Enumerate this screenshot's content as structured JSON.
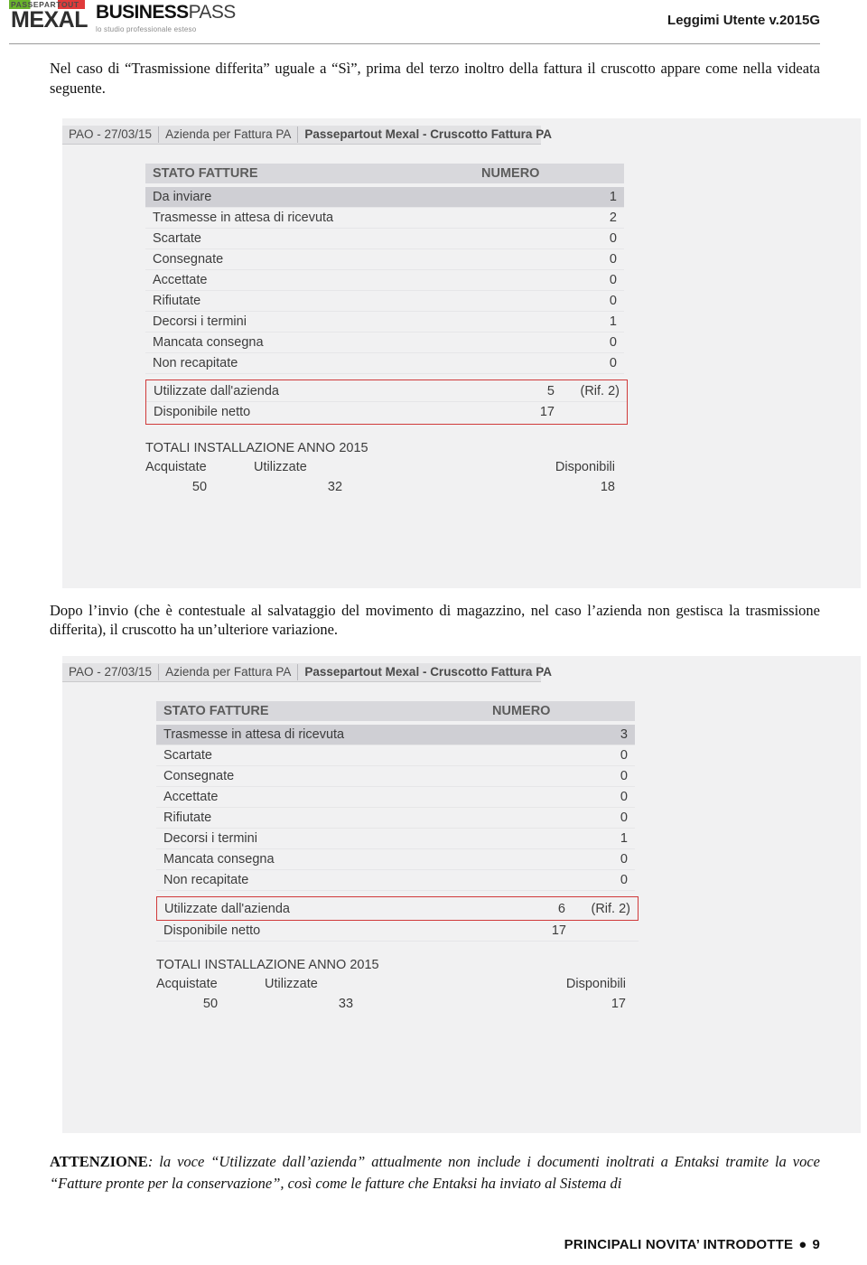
{
  "header": {
    "logo_top": "PASSEPARTOUT",
    "logo_main": "MEXAL",
    "logo_business": "BUSINESS",
    "logo_pass": "PASS",
    "logo_tagline": "lo studio professionale esteso",
    "doc_title": "Leggimi Utente v.2015G"
  },
  "paragraphs": {
    "intro": "Nel caso di “Trasmissione differita” uguale a “Sì”, prima del terzo inoltro della fattura il cruscotto appare come nella videata seguente.",
    "middle": "Dopo l’invio (che è contestuale al salvataggio del movimento di magazzino, nel caso l’azienda non gestisca la trasmissione differita), il cruscotto ha un’ulteriore variazione."
  },
  "note": {
    "label": "ATTENZIONE",
    "text": ": la voce “Utilizzate dall’azienda” attualmente non include i documenti inoltrati a Entaksi tramite la voce “Fatture pronte per la conservazione”, così come le fatture che Entaksi ha inviato al Sistema di"
  },
  "figure1": {
    "titlebar": [
      "PAO - 27/03/15",
      "Azienda per Fattura PA",
      "Passepartout Mexal - Cruscotto Fattura PA"
    ],
    "table_header": {
      "stato": "STATO FATTURE",
      "numero": "NUMERO"
    },
    "rows": [
      {
        "label": "Da inviare",
        "value": "1",
        "selected": true
      },
      {
        "label": "Trasmesse in attesa di ricevuta",
        "value": "2",
        "selected": false
      },
      {
        "label": "Scartate",
        "value": "0",
        "selected": false
      },
      {
        "label": "Consegnate",
        "value": "0",
        "selected": false
      },
      {
        "label": "Accettate",
        "value": "0",
        "selected": false
      },
      {
        "label": "Rifiutate",
        "value": "0",
        "selected": false
      },
      {
        "label": "Decorsi i termini",
        "value": "1",
        "selected": false
      },
      {
        "label": "Mancata consegna",
        "value": "0",
        "selected": false
      },
      {
        "label": "Non recapitate",
        "value": "0",
        "selected": false
      }
    ],
    "highlight": {
      "used_label": "Utilizzate dall'azienda",
      "used_value": "5",
      "used_rif": "(Rif.  2)",
      "net_label": "Disponibile netto",
      "net_value": "17"
    },
    "totals": {
      "title": "TOTALI INSTALLAZIONE ANNO 2015",
      "head": {
        "acquistate": "Acquistate",
        "utilizzate": "Utilizzate",
        "disponibili": "Disponibili"
      },
      "values": {
        "acquistate": "50",
        "utilizzate": "32",
        "disponibili": "18"
      }
    }
  },
  "figure2": {
    "titlebar": [
      "PAO - 27/03/15",
      "Azienda per Fattura PA",
      "Passepartout Mexal - Cruscotto Fattura PA"
    ],
    "table_header": {
      "stato": "STATO FATTURE",
      "numero": "NUMERO"
    },
    "rows": [
      {
        "label": "Trasmesse in attesa di ricevuta",
        "value": "3",
        "selected": true
      },
      {
        "label": "Scartate",
        "value": "0",
        "selected": false
      },
      {
        "label": "Consegnate",
        "value": "0",
        "selected": false
      },
      {
        "label": "Accettate",
        "value": "0",
        "selected": false
      },
      {
        "label": "Rifiutate",
        "value": "0",
        "selected": false
      },
      {
        "label": "Decorsi i termini",
        "value": "1",
        "selected": false
      },
      {
        "label": "Mancata consegna",
        "value": "0",
        "selected": false
      },
      {
        "label": "Non recapitate",
        "value": "0",
        "selected": false
      }
    ],
    "highlight": {
      "used_label": "Utilizzate dall'azienda",
      "used_value": "6",
      "used_rif": "(Rif.  2)",
      "net_label": "Disponibile netto",
      "net_value": "17"
    },
    "totals": {
      "title": "TOTALI INSTALLAZIONE ANNO 2015",
      "head": {
        "acquistate": "Acquistate",
        "utilizzate": "Utilizzate",
        "disponibili": "Disponibili"
      },
      "values": {
        "acquistate": "50",
        "utilizzate": "33",
        "disponibili": "17"
      }
    }
  },
  "footer": {
    "section": "PRINCIPALI NOVITA’ INTRODOTTE",
    "page": "9"
  },
  "colors": {
    "highlight_border": "#d03a3a",
    "figure_bg": "#f1f1f2",
    "header_row": "#d8d8dc",
    "selected_row": "#cfcfd4"
  }
}
